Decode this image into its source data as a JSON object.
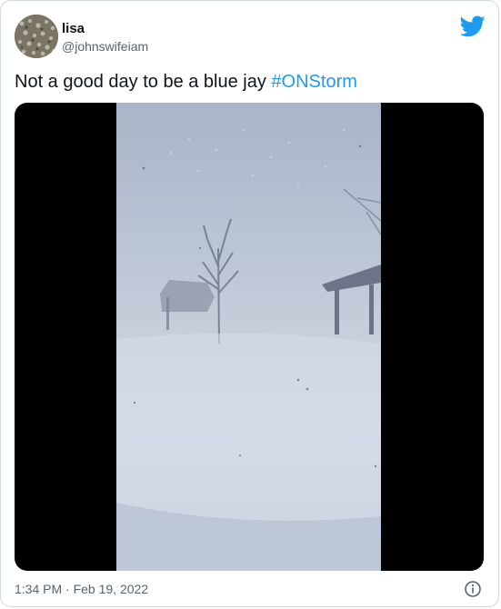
{
  "user": {
    "name": "lisa",
    "handle": "@johnswifeiam"
  },
  "tweet": {
    "text": "Not a good day to be a blue jay ",
    "hashtag": "#ONStorm",
    "timestamp": "1:34 PM · Feb 19, 2022"
  },
  "media": {
    "type": "video",
    "description_icon": "video-frame"
  },
  "icons": {
    "brand": "twitter-bird-icon",
    "info": "info-icon"
  },
  "colors": {
    "accent": "#1d9bf0",
    "text": "#0f1419",
    "secondary": "#536471"
  }
}
